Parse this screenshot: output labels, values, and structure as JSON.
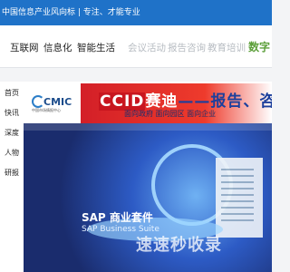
{
  "topbar": {
    "tagline": "中国信息产业风向标 | 专注、才能专业"
  },
  "nav": {
    "items": [
      {
        "label": "互联网",
        "style": "normal"
      },
      {
        "label": "信息化",
        "style": "normal"
      },
      {
        "label": "智能生活",
        "style": "normal"
      },
      {
        "label": "会议活动",
        "style": "muted"
      },
      {
        "label": "报告咨询",
        "style": "muted"
      },
      {
        "label": "教育培训",
        "style": "muted"
      },
      {
        "label": "数字",
        "style": "brand"
      }
    ]
  },
  "sidebar": {
    "items": [
      {
        "label": "首页"
      },
      {
        "label": "快讯"
      },
      {
        "label": "深度"
      },
      {
        "label": "人物"
      },
      {
        "label": "研报"
      }
    ]
  },
  "banner": {
    "logo_main": "CMIC",
    "logo_sub": "中国市场情报中心",
    "ccid": "CCID",
    "headline": "赛迪",
    "headline_tail": "——报告、咨询、调研",
    "subline": "面向政府   面向园区   面向企业"
  },
  "photo": {
    "title": "SAP 商业套件",
    "subtitle": "SAP Business Suite"
  },
  "watermark": "速速秒收录",
  "colors": {
    "topbar_blue": "#1f72c8",
    "brand_green": "#5c9f3a",
    "ccid_red": "#d31f27"
  }
}
